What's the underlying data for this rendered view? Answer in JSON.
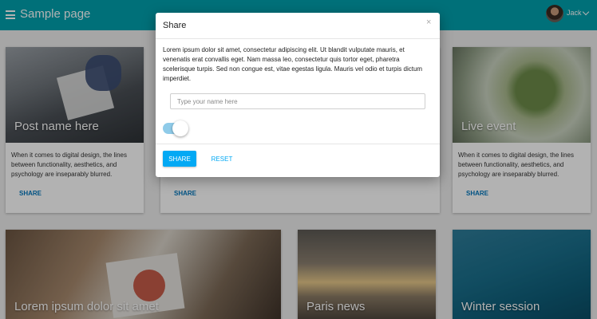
{
  "header": {
    "title": "Sample page",
    "user_name": "Jack",
    "color": "#00a1ae"
  },
  "cards": [
    {
      "title": "Post name here",
      "text": "When it comes to digital design, the lines between functionality, aesthetics, and psychology are inseparably blurred.",
      "action": "SHARE"
    },
    {
      "title": "",
      "text": "",
      "action": "SHARE"
    },
    {
      "title": "Live event",
      "text": "When it comes to digital design, the lines between functionality, aesthetics, and psychology are inseparably blurred.",
      "action": "SHARE"
    },
    {
      "title": "Lorem ipsum dolor sit amet"
    },
    {
      "title": "Paris news"
    },
    {
      "title": "Winter session"
    }
  ],
  "dialog": {
    "title": "Share",
    "close_icon": "close-icon",
    "body": "Lorem ipsum dolor sit amet, consectetur adipiscing elit. Ut blandit vulputate mauris, et venenatis erat convallis eget. Nam massa leo, consectetur quis tortor eget, pharetra scelerisque turpis. Sed non congue est, vitae egestas ligula. Mauris vel odio et turpis dictum imperdiet.",
    "input_placeholder": "Type your name here",
    "input_value": "",
    "toggle_on": true,
    "share_label": "SHARE",
    "reset_label": "RESET",
    "accent_color": "#03a9f4"
  }
}
